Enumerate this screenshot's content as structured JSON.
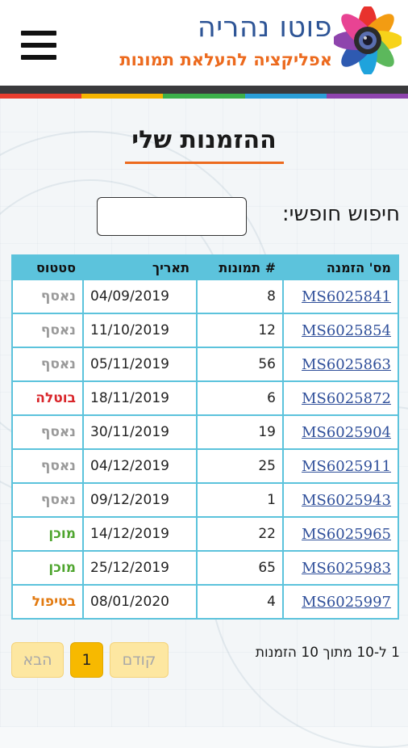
{
  "header": {
    "brand_name": "פוטו נהריה",
    "brand_tagline": "אפליקציה להעלאת תמונות",
    "menu_icon": "hamburger-menu-icon",
    "stripe_colors": [
      "#e83d2e",
      "#f5b400",
      "#3cb04a",
      "#2a9fd8",
      "#8e44ad"
    ]
  },
  "page": {
    "title": "ההזמנות שלי",
    "search_label": "חיפוש חופשי:",
    "search_value": ""
  },
  "table": {
    "headers": {
      "order": "מס' הזמנה",
      "photos": "# תמונות",
      "date": "תאריך",
      "status": "סטטוס"
    },
    "rows": [
      {
        "order": "MS6025841",
        "photos": "8",
        "date": "04/09/2019",
        "status": "נאסף"
      },
      {
        "order": "MS6025854",
        "photos": "12",
        "date": "11/10/2019",
        "status": "נאסף"
      },
      {
        "order": "MS6025863",
        "photos": "56",
        "date": "05/11/2019",
        "status": "נאסף"
      },
      {
        "order": "MS6025872",
        "photos": "6",
        "date": "18/11/2019",
        "status": "בוטלה"
      },
      {
        "order": "MS6025904",
        "photos": "19",
        "date": "30/11/2019",
        "status": "נאסף"
      },
      {
        "order": "MS6025911",
        "photos": "25",
        "date": "04/12/2019",
        "status": "נאסף"
      },
      {
        "order": "MS6025943",
        "photos": "1",
        "date": "09/12/2019",
        "status": "נאסף"
      },
      {
        "order": "MS6025965",
        "photos": "22",
        "date": "14/12/2019",
        "status": "מוכן"
      },
      {
        "order": "MS6025983",
        "photos": "65",
        "date": "25/12/2019",
        "status": "מוכן"
      },
      {
        "order": "MS6025997",
        "photos": "4",
        "date": "08/01/2020",
        "status": "בטיפול"
      }
    ],
    "status_colors": {
      "נאסף": "#9a9a9a",
      "בוטלה": "#d9262b",
      "מוכן": "#4ea52e",
      "בטיפול": "#e27a10"
    }
  },
  "pagination": {
    "info": "1 ל-10 מתוך 10 הזמנות",
    "prev_label": "קודם",
    "current_page": "1",
    "next_label": "הבא"
  },
  "colors": {
    "brand_blue": "#2e5596",
    "brand_orange": "#ec6a1e",
    "table_border": "#5cc3dc",
    "page_active": "#f7b900"
  }
}
